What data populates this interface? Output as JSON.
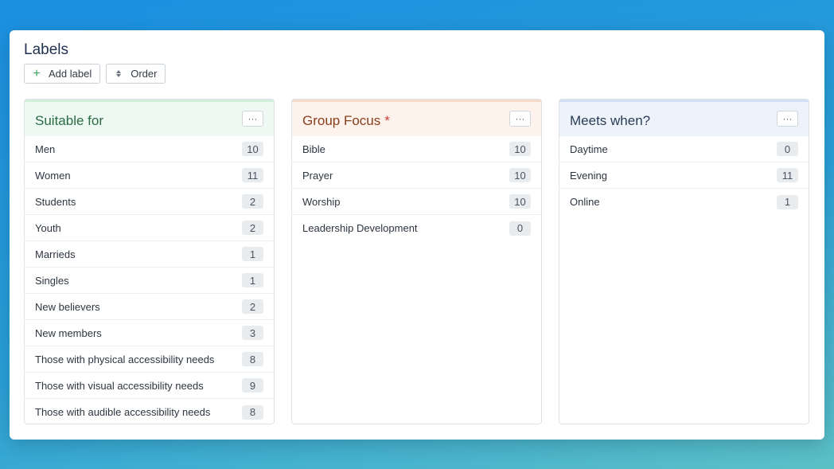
{
  "page": {
    "title": "Labels"
  },
  "toolbar": {
    "add_label": "Add label",
    "order": "Order"
  },
  "columns": [
    {
      "title": "Suitable for",
      "required_marker": "",
      "more_label": "···",
      "items": [
        {
          "label": "Men",
          "count": "10"
        },
        {
          "label": "Women",
          "count": "11"
        },
        {
          "label": "Students",
          "count": "2"
        },
        {
          "label": "Youth",
          "count": "2"
        },
        {
          "label": "Marrieds",
          "count": "1"
        },
        {
          "label": "Singles",
          "count": "1"
        },
        {
          "label": "New believers",
          "count": "2"
        },
        {
          "label": "New members",
          "count": "3"
        },
        {
          "label": "Those with physical accessibility needs",
          "count": "8"
        },
        {
          "label": "Those with visual accessibility needs",
          "count": "9"
        },
        {
          "label": "Those with audible accessibility needs",
          "count": "8"
        }
      ]
    },
    {
      "title": "Group Focus",
      "required_marker": "*",
      "more_label": "···",
      "items": [
        {
          "label": "Bible",
          "count": "10"
        },
        {
          "label": "Prayer",
          "count": "10"
        },
        {
          "label": "Worship",
          "count": "10"
        },
        {
          "label": "Leadership Development",
          "count": "0"
        }
      ]
    },
    {
      "title": "Meets when?",
      "required_marker": "",
      "more_label": "···",
      "items": [
        {
          "label": "Daytime",
          "count": "0"
        },
        {
          "label": "Evening",
          "count": "11"
        },
        {
          "label": "Online",
          "count": "1"
        }
      ]
    }
  ],
  "icons": {
    "add": "plus-icon",
    "order": "sort-icon",
    "more": "more-horizontal-icon"
  },
  "colors": {
    "accent_green": "#3aa35b",
    "required_red": "#d0413a"
  }
}
